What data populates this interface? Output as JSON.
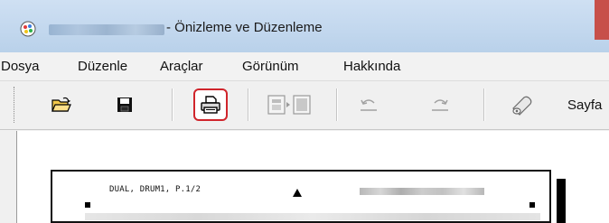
{
  "window": {
    "title": "- Önizleme ve Düzenleme",
    "colors": {
      "titlebar": "#c3d8ee",
      "close": "#c7504a",
      "highlight": "#d0252c"
    }
  },
  "menu": {
    "items": [
      "Dosya",
      "Düzenle",
      "Araçlar",
      "Görünüm",
      "Hakkında"
    ]
  },
  "toolbar": {
    "buttons": [
      {
        "name": "open",
        "icon": "folder-open-icon"
      },
      {
        "name": "save",
        "icon": "floppy-disk-icon"
      },
      {
        "name": "print",
        "icon": "printer-icon",
        "highlighted": true
      },
      {
        "name": "page-layout",
        "icon": "page-layout-icon",
        "disabled": true
      },
      {
        "name": "undo",
        "icon": "undo-icon",
        "disabled": true
      },
      {
        "name": "redo",
        "icon": "redo-icon",
        "disabled": true
      },
      {
        "name": "eraser",
        "icon": "eraser-icon"
      }
    ],
    "trailing_label": "Sayfa"
  },
  "preview": {
    "page_header": "DUAL, DRUM1, P.1/2"
  }
}
